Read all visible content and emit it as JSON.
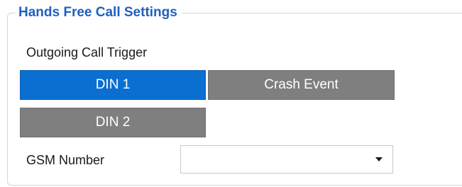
{
  "section": {
    "title": "Hands Free Call Settings"
  },
  "outgoing_call_trigger": {
    "label": "Outgoing Call Trigger",
    "options": [
      {
        "label": "DIN 1",
        "selected": true
      },
      {
        "label": "Crash Event",
        "selected": false
      },
      {
        "label": "DIN 2",
        "selected": false
      }
    ]
  },
  "gsm_number": {
    "label": "GSM Number",
    "value": ""
  },
  "icons": {
    "dropdown": "chevron-down-icon"
  },
  "colors": {
    "title": "#1f5fbf",
    "selected": "#0a6fd1",
    "unselected": "#7f7f7f"
  }
}
